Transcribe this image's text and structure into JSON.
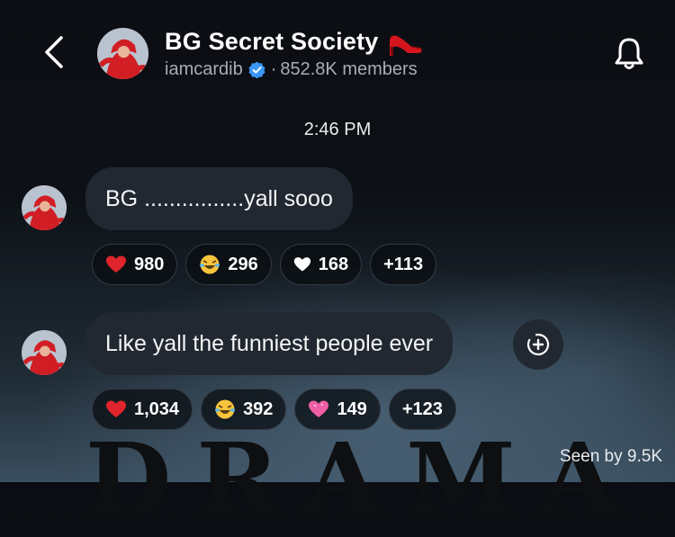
{
  "header": {
    "back_icon": "chevron-left-icon",
    "title": "BG Secret Society",
    "title_emoji": "high-heel-icon",
    "owner": "iamcardib",
    "verified_icon": "verified-badge-icon",
    "separator": "·",
    "members": "852.8K members",
    "bell_icon": "bell-icon"
  },
  "timestamp": "2:46 PM",
  "messages": [
    {
      "text": "BG ................yall sooo",
      "reactions": [
        {
          "emoji": "red-heart-icon",
          "count": "980"
        },
        {
          "emoji": "laughing-tears-icon",
          "count": "296"
        },
        {
          "emoji": "white-heart-icon",
          "count": "168"
        },
        {
          "emoji": "",
          "count": "+113"
        }
      ]
    },
    {
      "text": "Like yall the funniest people ever",
      "reactions": [
        {
          "emoji": "red-heart-icon",
          "count": "1,034"
        },
        {
          "emoji": "laughing-tears-icon",
          "count": "392"
        },
        {
          "emoji": "pink-heart-icon",
          "count": "149"
        },
        {
          "emoji": "",
          "count": "+123"
        }
      ]
    }
  ],
  "add_reaction_icon": "add-reaction-icon",
  "background_text": "DRAMA",
  "seen": "Seen by 9.5K",
  "colors": {
    "background": "#0b0d12",
    "bubble": "#222831",
    "secondary_text": "#a8adb4",
    "verified": "#3b96f5",
    "red_heart": "#e0242b",
    "pink_heart": "#ef5fa5"
  }
}
